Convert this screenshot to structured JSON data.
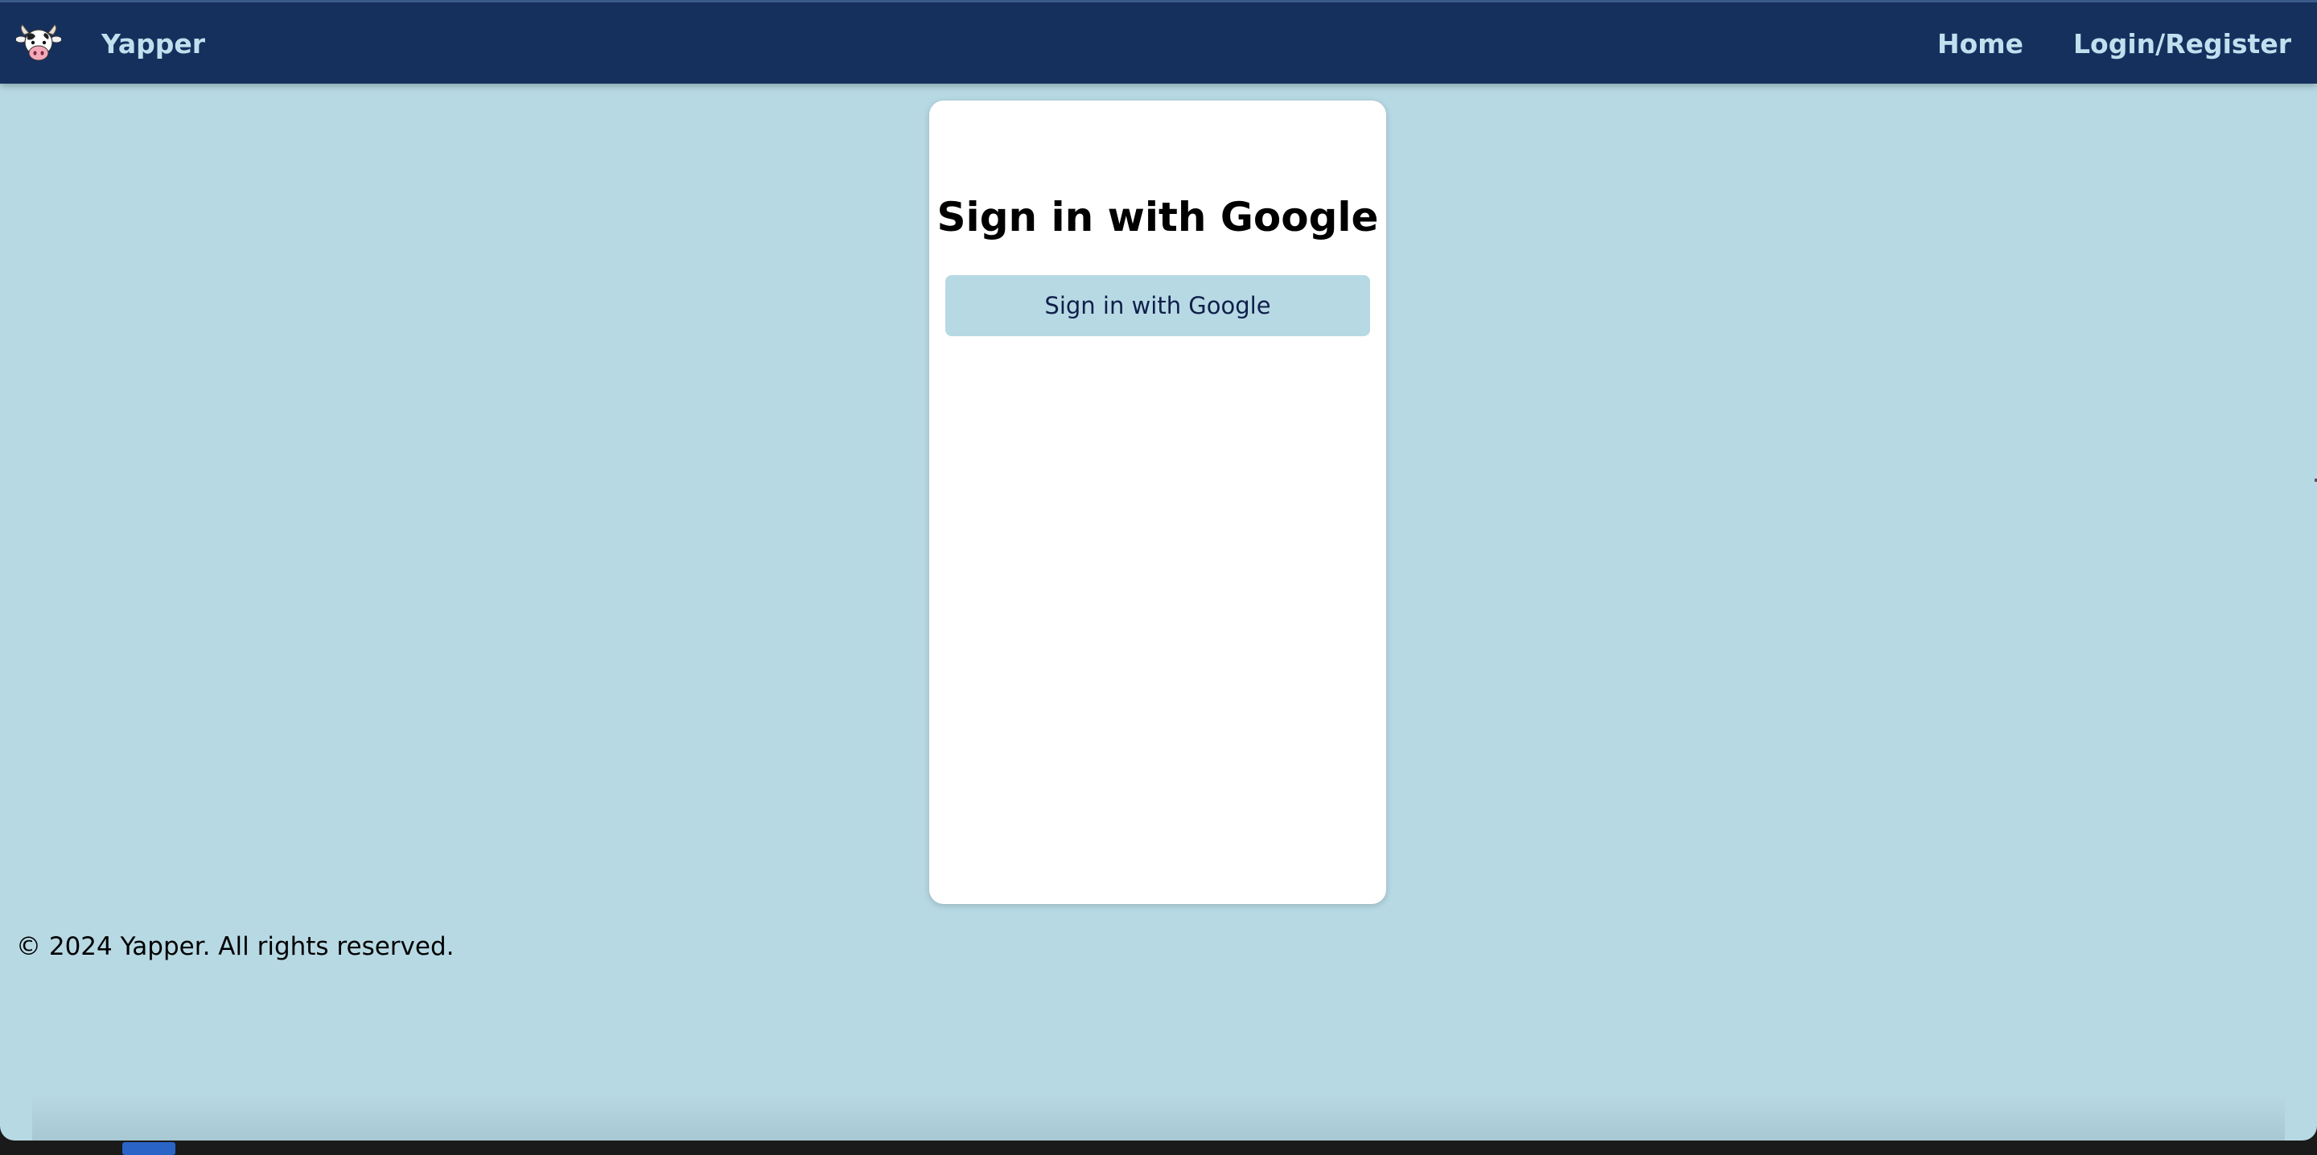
{
  "navbar": {
    "brand": "Yapper",
    "logo_icon": "cow-face-icon",
    "links": [
      {
        "label": "Home"
      },
      {
        "label": "Login/Register"
      }
    ]
  },
  "card": {
    "title": "Sign in with Google",
    "button_label": "Sign in with Google"
  },
  "footer": {
    "text": "© 2024 Yapper. All rights reserved."
  },
  "colors": {
    "navbar_bg": "#16305e",
    "nav_text": "#bfe0ee",
    "page_bg": "#b7d9e4",
    "card_bg": "#ffffff",
    "button_bg": "#b7d9e4",
    "button_text": "#0f1f4a"
  }
}
